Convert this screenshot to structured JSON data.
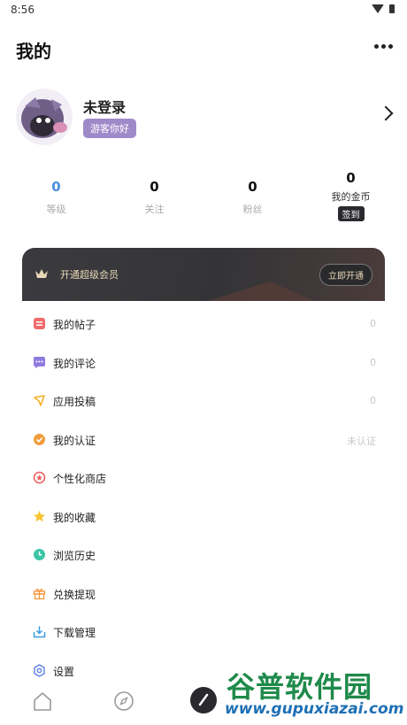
{
  "status": {
    "time": "8:56"
  },
  "header": {
    "title": "我的"
  },
  "profile": {
    "name": "未登录",
    "badge": "游客你好"
  },
  "stats": [
    {
      "value": "0",
      "label": "等级"
    },
    {
      "value": "0",
      "label": "关注"
    },
    {
      "value": "0",
      "label": "粉丝"
    },
    {
      "value": "0",
      "label": "我的金币",
      "action": "签到"
    }
  ],
  "vip": {
    "label": "开通超级会员",
    "button": "立即开通"
  },
  "menu": [
    {
      "label": "我的帖子",
      "value": "0",
      "icon": "post-icon"
    },
    {
      "label": "我的评论",
      "value": "0",
      "icon": "comment-icon"
    },
    {
      "label": "应用投稿",
      "value": "0",
      "icon": "submit-icon"
    },
    {
      "label": "我的认证",
      "value": "未认证",
      "icon": "verify-icon"
    },
    {
      "label": "个性化商店",
      "value": "",
      "icon": "store-icon"
    },
    {
      "label": "我的收藏",
      "value": "",
      "icon": "star-icon"
    },
    {
      "label": "浏览历史",
      "value": "",
      "icon": "clock-icon"
    },
    {
      "label": "兑换提现",
      "value": "",
      "icon": "gift-icon"
    },
    {
      "label": "下载管理",
      "value": "",
      "icon": "download-icon"
    },
    {
      "label": "设置",
      "value": "",
      "icon": "settings-icon"
    }
  ],
  "watermark": {
    "logo": "谷普软件园",
    "url": "www.gupuxiazai.com"
  },
  "colors": {
    "accent_blue": "#4a8ee0",
    "badge_purple": "#9f8ac9",
    "vip_dark": "#343437",
    "vip_gold": "#e9d8b8"
  }
}
